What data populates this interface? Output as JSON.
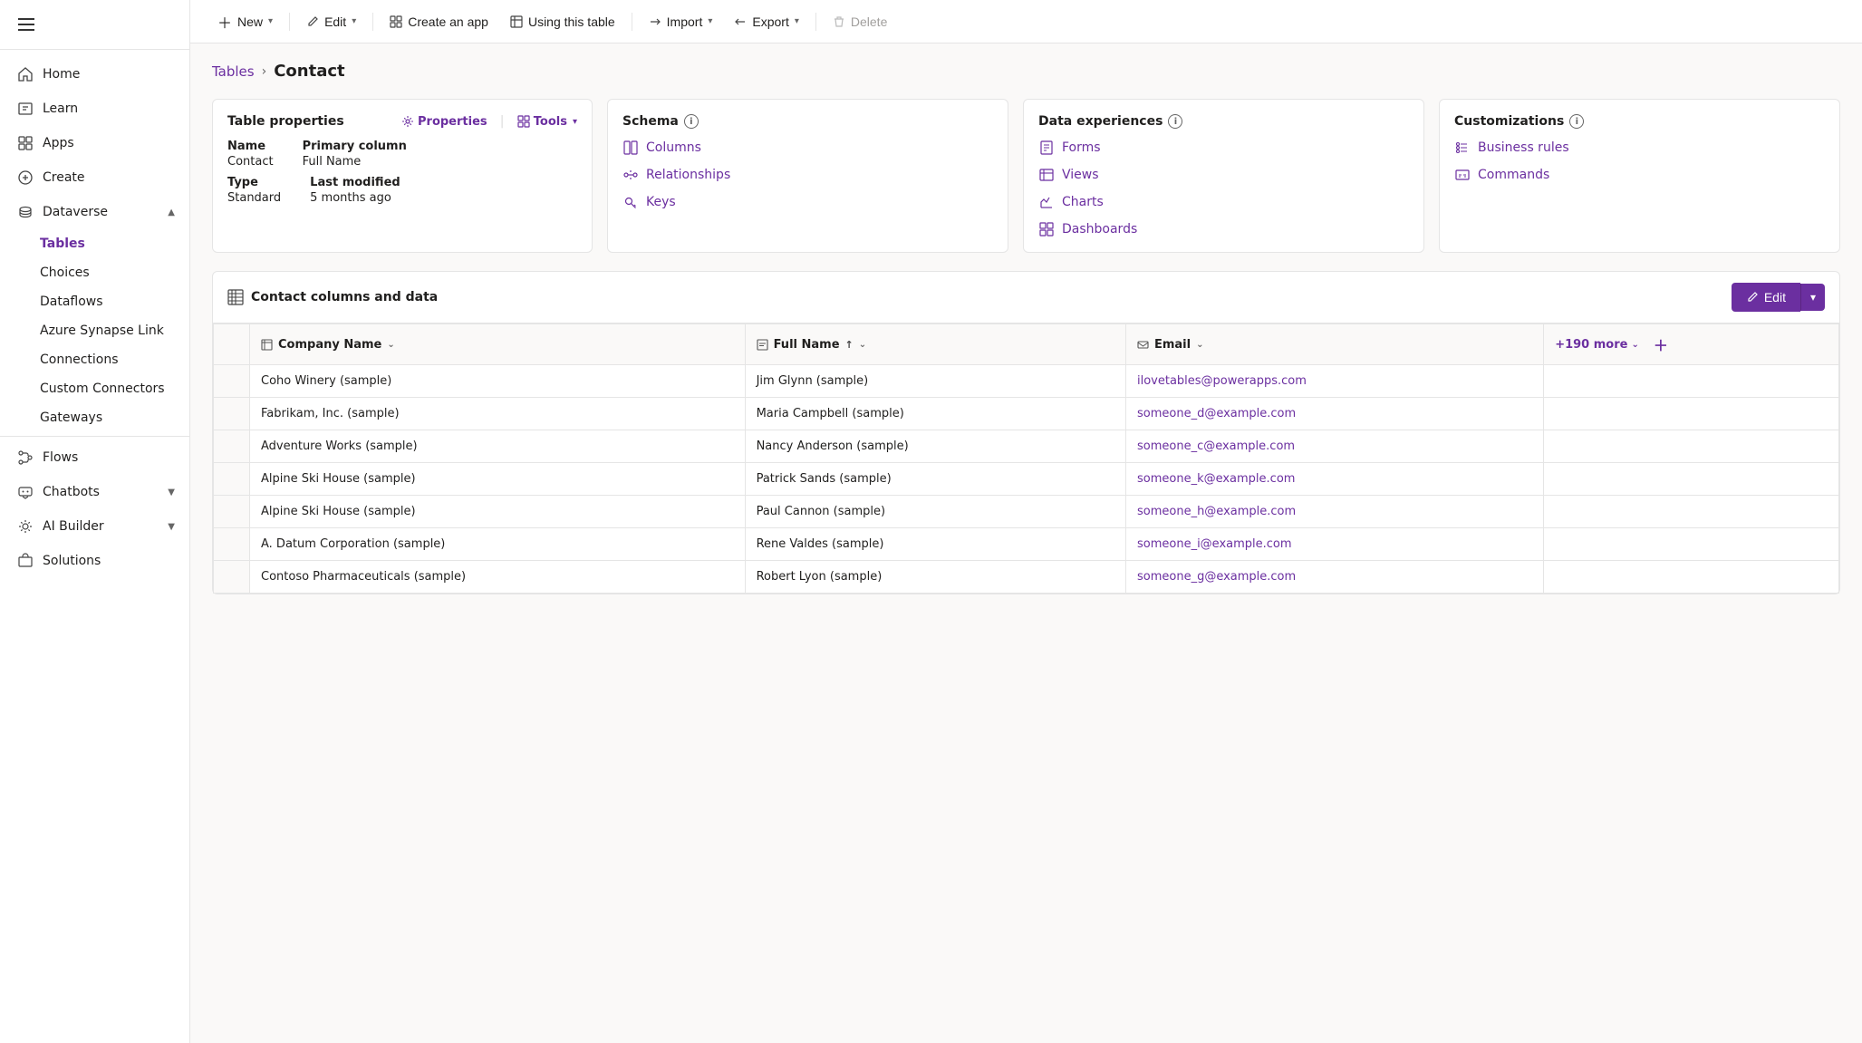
{
  "sidebar": {
    "hamburger_label": "Menu",
    "items": [
      {
        "id": "home",
        "label": "Home",
        "icon": "home"
      },
      {
        "id": "learn",
        "label": "Learn",
        "icon": "learn"
      },
      {
        "id": "apps",
        "label": "Apps",
        "icon": "apps"
      },
      {
        "id": "create",
        "label": "Create",
        "icon": "create"
      },
      {
        "id": "dataverse",
        "label": "Dataverse",
        "icon": "dataverse",
        "expanded": true
      },
      {
        "id": "tables",
        "label": "Tables",
        "icon": null,
        "sub": true,
        "active": true
      },
      {
        "id": "choices",
        "label": "Choices",
        "icon": null,
        "sub": true
      },
      {
        "id": "dataflows",
        "label": "Dataflows",
        "icon": null,
        "sub": true
      },
      {
        "id": "azure-synapse",
        "label": "Azure Synapse Link",
        "icon": null,
        "sub": true
      },
      {
        "id": "connections",
        "label": "Connections",
        "icon": null,
        "sub": true
      },
      {
        "id": "custom-connectors",
        "label": "Custom Connectors",
        "icon": null,
        "sub": true
      },
      {
        "id": "gateways",
        "label": "Gateways",
        "icon": null,
        "sub": true
      },
      {
        "id": "flows",
        "label": "Flows",
        "icon": "flows"
      },
      {
        "id": "chatbots",
        "label": "Chatbots",
        "icon": "chatbots",
        "expandable": true
      },
      {
        "id": "ai-builder",
        "label": "AI Builder",
        "icon": "ai-builder",
        "expandable": true
      },
      {
        "id": "solutions",
        "label": "Solutions",
        "icon": "solutions"
      }
    ]
  },
  "toolbar": {
    "new_label": "New",
    "edit_label": "Edit",
    "create_app_label": "Create an app",
    "using_this_table_label": "Using this table",
    "import_label": "Import",
    "export_label": "Export",
    "delete_label": "Delete"
  },
  "breadcrumb": {
    "parent": "Tables",
    "separator": "›",
    "current": "Contact"
  },
  "table_properties_card": {
    "title": "Table properties",
    "properties_link": "Properties",
    "tools_link": "Tools",
    "name_label": "Name",
    "name_value": "Contact",
    "type_label": "Type",
    "type_value": "Standard",
    "primary_column_label": "Primary column",
    "primary_column_value": "Full Name",
    "last_modified_label": "Last modified",
    "last_modified_value": "5 months ago"
  },
  "schema_card": {
    "title": "Schema",
    "info_tooltip": "Schema information",
    "items": [
      {
        "id": "columns",
        "label": "Columns"
      },
      {
        "id": "relationships",
        "label": "Relationships"
      },
      {
        "id": "keys",
        "label": "Keys"
      }
    ]
  },
  "data_experiences_card": {
    "title": "Data experiences",
    "info_tooltip": "Data experiences information",
    "items": [
      {
        "id": "forms",
        "label": "Forms"
      },
      {
        "id": "views",
        "label": "Views"
      },
      {
        "id": "charts",
        "label": "Charts"
      },
      {
        "id": "dashboards",
        "label": "Dashboards"
      }
    ]
  },
  "customizations_card": {
    "title": "Customizations",
    "info_tooltip": "Customizations information",
    "items": [
      {
        "id": "business-rules",
        "label": "Business rules"
      },
      {
        "id": "commands",
        "label": "Commands"
      }
    ]
  },
  "contact_table": {
    "title": "Contact columns and data",
    "edit_label": "Edit",
    "columns": [
      {
        "id": "company-name",
        "label": "Company Name",
        "icon": "table-icon"
      },
      {
        "id": "full-name",
        "label": "Full Name",
        "icon": "text-icon",
        "sorted": true
      },
      {
        "id": "email",
        "label": "Email",
        "icon": "email-icon"
      },
      {
        "id": "more",
        "label": "+190 more"
      }
    ],
    "rows": [
      {
        "company": "Coho Winery (sample)",
        "fullname": "Jim Glynn (sample)",
        "email": "ilovetables@powerapps.com"
      },
      {
        "company": "Fabrikam, Inc. (sample)",
        "fullname": "Maria Campbell (sample)",
        "email": "someone_d@example.com"
      },
      {
        "company": "Adventure Works (sample)",
        "fullname": "Nancy Anderson (sample)",
        "email": "someone_c@example.com"
      },
      {
        "company": "Alpine Ski House (sample)",
        "fullname": "Patrick Sands (sample)",
        "email": "someone_k@example.com"
      },
      {
        "company": "Alpine Ski House (sample)",
        "fullname": "Paul Cannon (sample)",
        "email": "someone_h@example.com"
      },
      {
        "company": "A. Datum Corporation (sample)",
        "fullname": "Rene Valdes (sample)",
        "email": "someone_i@example.com"
      },
      {
        "company": "Contoso Pharmaceuticals (sample)",
        "fullname": "Robert Lyon (sample)",
        "email": "someone_g@example.com"
      }
    ]
  },
  "colors": {
    "purple": "#6b2fa0",
    "light_purple": "#8344b8"
  }
}
